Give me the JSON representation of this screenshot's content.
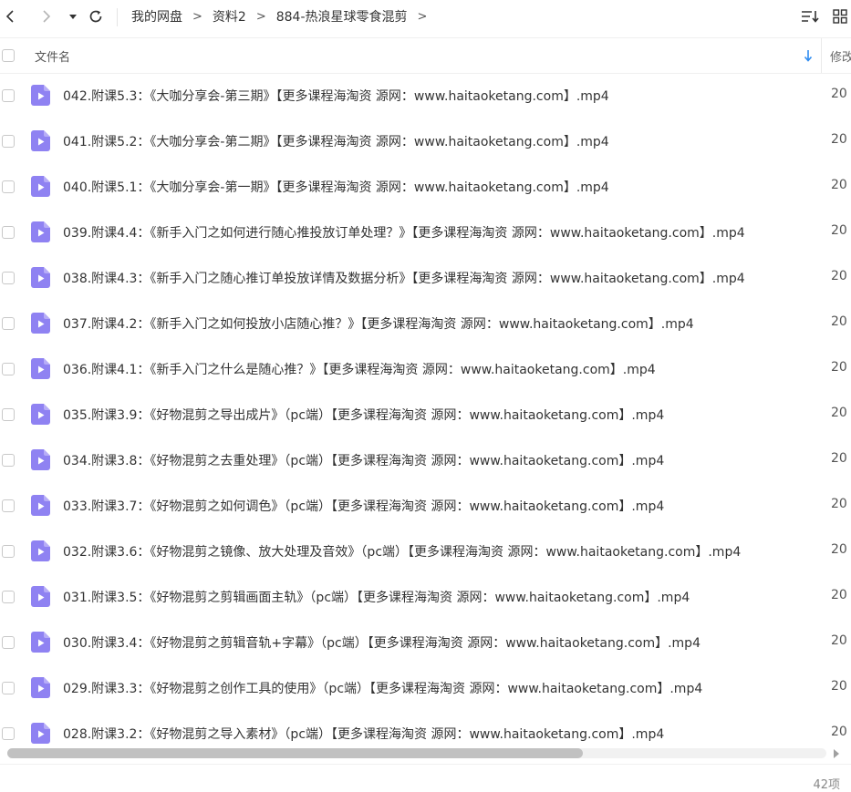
{
  "toolbar": {
    "breadcrumb": [
      "我的网盘",
      "资料2",
      "884-热浪星球零食混剪"
    ],
    "separator": ">",
    "back_icon": "chevron-left-icon",
    "forward_icon": "chevron-right-icon",
    "dropdown_icon": "caret-down-icon",
    "refresh_icon": "refresh-icon",
    "sort_icon": "sort-list-icon",
    "view_icon": "grid-view-icon"
  },
  "header": {
    "name_label": "文件名",
    "modified_label": "修改",
    "sort_icon": "sort-down-arrow-icon"
  },
  "files": [
    {
      "name": "042.附课5.3：《大咖分享会-第三期》【更多课程海淘资 源网：www.haitaoketang.com】.mp4",
      "date": "20"
    },
    {
      "name": "041.附课5.2：《大咖分享会-第二期》【更多课程海淘资 源网：www.haitaoketang.com】.mp4",
      "date": "20"
    },
    {
      "name": "040.附课5.1：《大咖分享会-第一期》【更多课程海淘资 源网：www.haitaoketang.com】.mp4",
      "date": "20"
    },
    {
      "name": "039.附课4.4：《新手入门之如何进行随心推投放订单处理？》【更多课程海淘资 源网：www.haitaoketang.com】.mp4",
      "date": "20"
    },
    {
      "name": "038.附课4.3：《新手入门之随心推订单投放详情及数据分析》【更多课程海淘资 源网：www.haitaoketang.com】.mp4",
      "date": "20"
    },
    {
      "name": "037.附课4.2：《新手入门之如何投放小店随心推？》【更多课程海淘资 源网：www.haitaoketang.com】.mp4",
      "date": "20"
    },
    {
      "name": "036.附课4.1：《新手入门之什么是随心推？》【更多课程海淘资 源网：www.haitaoketang.com】.mp4",
      "date": "20"
    },
    {
      "name": "035.附课3.9：《好物混剪之导出成片》（pc端）【更多课程海淘资 源网：www.haitaoketang.com】.mp4",
      "date": "20"
    },
    {
      "name": "034.附课3.8：《好物混剪之去重处理》（pc端）【更多课程海淘资 源网：www.haitaoketang.com】.mp4",
      "date": "20"
    },
    {
      "name": "033.附课3.7：《好物混剪之如何调色》（pc端）【更多课程海淘资 源网：www.haitaoketang.com】.mp4",
      "date": "20"
    },
    {
      "name": "032.附课3.6：《好物混剪之镜像、放大处理及音效》（pc端）【更多课程海淘资 源网：www.haitaoketang.com】.mp4",
      "date": "20"
    },
    {
      "name": "031.附课3.5：《好物混剪之剪辑画面主轨》（pc端）【更多课程海淘资 源网：www.haitaoketang.com】.mp4",
      "date": "20"
    },
    {
      "name": "030.附课3.4：《好物混剪之剪辑音轨+字幕》（pc端）【更多课程海淘资 源网：www.haitaoketang.com】.mp4",
      "date": "20"
    },
    {
      "name": "029.附课3.3：《好物混剪之创作工具的使用》（pc端）【更多课程海淘资 源网：www.haitaoketang.com】.mp4",
      "date": "20"
    },
    {
      "name": "028.附课3.2：《好物混剪之导入素材》（pc端）【更多课程海淘资 源网：www.haitaoketang.com】.mp4",
      "date": "20"
    }
  ],
  "file_icon": "video-file-icon",
  "footer": {
    "count": "42项"
  },
  "colors": {
    "accent": "#2f8cf0",
    "file_icon": "#8f82f2",
    "text": "#333333"
  }
}
